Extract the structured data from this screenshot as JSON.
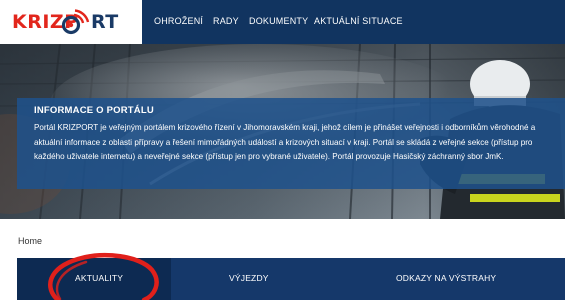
{
  "brand": {
    "logo_left": "KRIZP",
    "logo_right": "RT",
    "red": "#e2261c",
    "navy": "#1a3a66"
  },
  "nav": {
    "items": [
      {
        "label": "OHROŽENÍ"
      },
      {
        "label": "RADY"
      },
      {
        "label": "DOKUMENTY"
      },
      {
        "label": "AKTUÁLNÍ SITUACE"
      }
    ]
  },
  "info": {
    "title": "INFORMACE O PORTÁLU",
    "lines": [
      "Portál KRIZPORT je veřejným portálem krizového řízení v Jihomoravském kraji, jehož cílem je přinášet veřejnosti i odborníkům věrohodné a",
      "aktuální informace z oblasti přípravy a řešení mimořádných událostí a krizových situací v kraji. Portál se skládá z veřejné sekce (přístup pro",
      "každého uživatele internetu) a neveřejné sekce (přístup jen pro vybrané uživatele). Portál provozuje Hasičský záchranný sbor JmK."
    ]
  },
  "breadcrumb": {
    "home": "Home"
  },
  "tabs": {
    "items": [
      {
        "label": "AKTUALITY",
        "active": true
      },
      {
        "label": "VÝJEZDY",
        "active": false
      },
      {
        "label": "ODKAZY NA VÝSTRAHY",
        "active": false
      }
    ]
  },
  "colors": {
    "nav_bg": "#113460",
    "tab_bg": "#15386a",
    "tab_active_bg": "#0d2a52",
    "annotation": "#e0201b"
  }
}
